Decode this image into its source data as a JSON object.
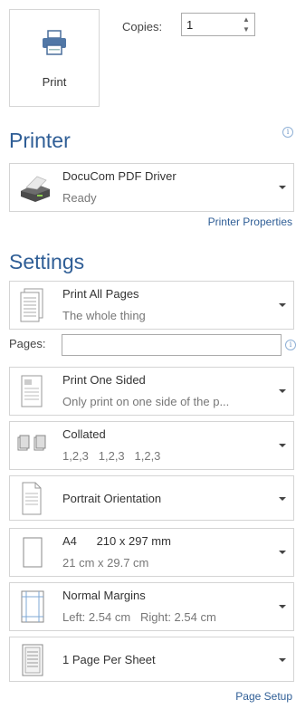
{
  "print_button": {
    "label": "Print",
    "icon": "printer-icon"
  },
  "copies": {
    "label": "Copies:",
    "value": "1"
  },
  "printer": {
    "title": "Printer",
    "name": "DocuCom PDF Driver",
    "status": "Ready",
    "properties_link": "Printer Properties",
    "icon": "printer-device-icon"
  },
  "settings": {
    "title": "Settings",
    "pages_label": "Pages:",
    "pages_value": "",
    "items": [
      {
        "line1": "Print All Pages",
        "line2": "The whole thing",
        "icon": "pages-icon"
      },
      {
        "line1": "Print One Sided",
        "line2": "Only print on one side of the p...",
        "icon": "one-sided-icon"
      },
      {
        "line1": "Collated",
        "line2": "1,2,3   1,2,3   1,2,3",
        "icon": "collated-icon"
      },
      {
        "line1": "Portrait Orientation",
        "icon": "portrait-icon"
      },
      {
        "line1": "A4      210 x 297 mm",
        "line2": "21 cm x 29.7 cm",
        "icon": "paper-size-icon"
      },
      {
        "line1": "Normal Margins",
        "line2": "Left: 2.54 cm   Right: 2.54 cm",
        "icon": "margins-icon"
      },
      {
        "line1": "1 Page Per Sheet",
        "icon": "pages-per-sheet-icon"
      }
    ],
    "page_setup_link": "Page Setup"
  }
}
